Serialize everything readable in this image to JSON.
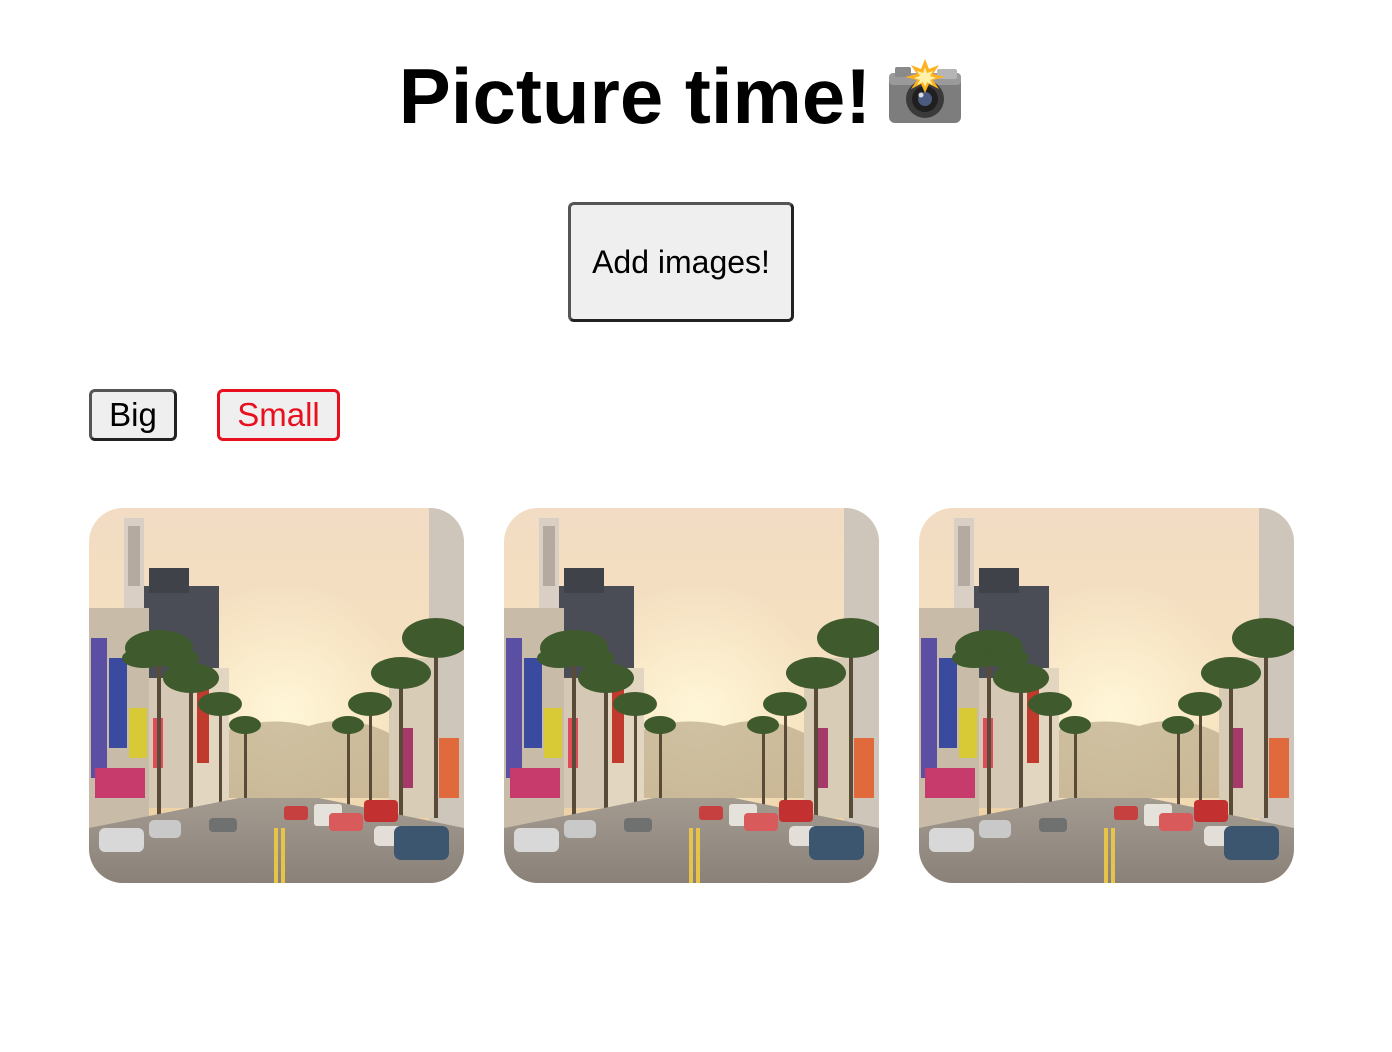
{
  "header": {
    "title": "Picture time!",
    "icon": "camera-flash-icon"
  },
  "actions": {
    "add_label": "Add images!"
  },
  "size_toggle": {
    "big_label": "Big",
    "small_label": "Small",
    "selected": "Small",
    "selected_color": "#e8101f"
  },
  "gallery": {
    "images": [
      {
        "subject": "Hollywood Boulevard street at sunset with palm trees and traffic"
      },
      {
        "subject": "Hollywood Boulevard street at sunset with palm trees and traffic"
      },
      {
        "subject": "Hollywood Boulevard street at sunset with palm trees and traffic"
      }
    ]
  }
}
